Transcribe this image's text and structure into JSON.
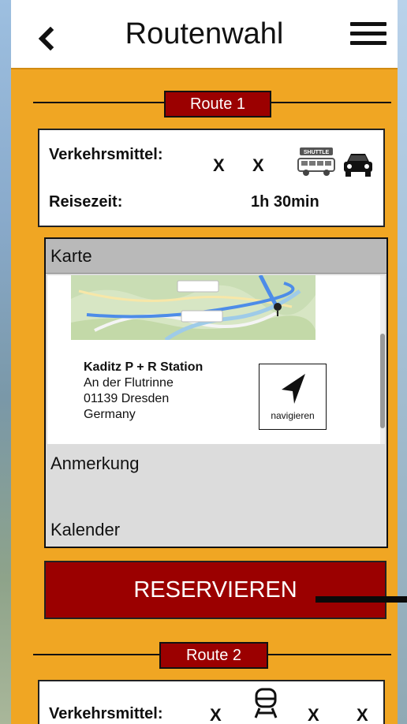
{
  "header": {
    "title": "Routenwahl"
  },
  "route1": {
    "label": "Route 1",
    "verkehrsmittel_label": "Verkehrsmittel:",
    "transport": [
      "X",
      "X"
    ],
    "transport_icons": [
      "shuttle-icon",
      "car-icon"
    ],
    "shuttle_icon_text": "SHUTTLE",
    "reisezeit_label": "Reisezeit:",
    "reisezeit_value": "1h 30min"
  },
  "accordion": {
    "karte_label": "Karte",
    "location": {
      "name": "Kaditz  P + R Station",
      "street": "An der Flutrinne",
      "city": "01139 Dresden",
      "country": "Germany"
    },
    "navigate_label": "navigieren",
    "anmerkung_label": "Anmerkung",
    "kalender_label": "Kalender"
  },
  "reserve": {
    "label": "RESERVIEREN"
  },
  "route2": {
    "label": "Route 2",
    "verkehrsmittel_label": "Verkehrsmittel:",
    "transport": [
      "X",
      "X",
      "X"
    ],
    "transport_icons": [
      "train-icon"
    ]
  },
  "colors": {
    "background": "#f0a623",
    "accent": "#9b0000",
    "header": "#ffffff"
  }
}
